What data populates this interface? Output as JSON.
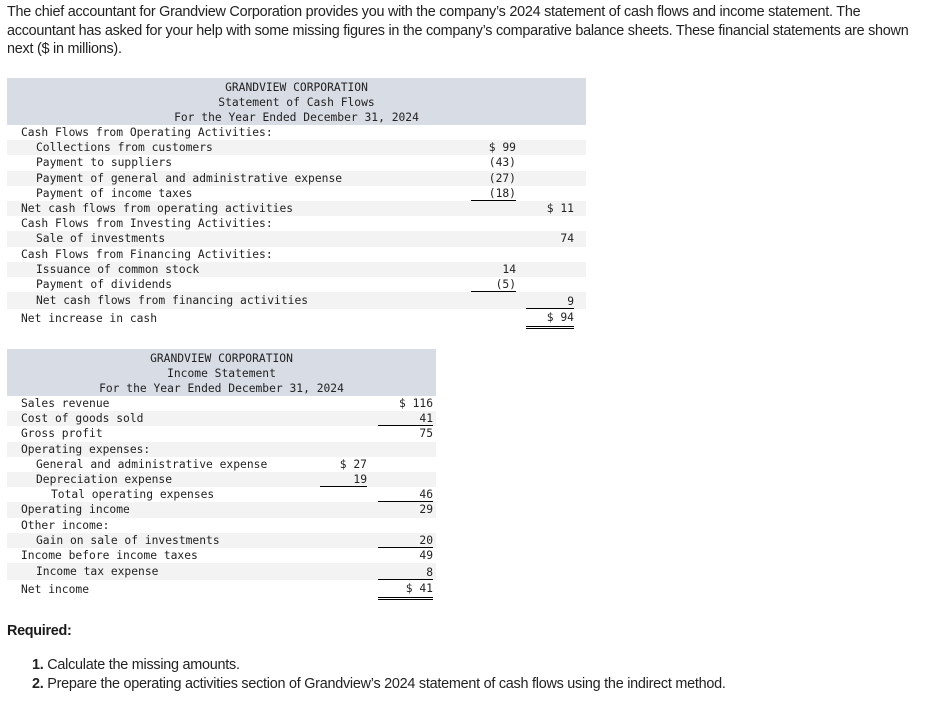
{
  "intro": "The chief accountant for Grandview Corporation provides you with the company’s 2024 statement of cash flows and income statement. The accountant has asked for your help with some missing figures in the company’s comparative balance sheets. These financial statements are shown next ($ in millions).",
  "cash_flows": {
    "company": "GRANDVIEW CORPORATION",
    "title": "Statement of Cash Flows",
    "period": "For the Year Ended December 31, 2024",
    "rows": [
      {
        "label": "Cash Flows from Operating Activities:",
        "c1": "",
        "c2": ""
      },
      {
        "label": "Collections from customers",
        "c1": "$ 99",
        "c2": ""
      },
      {
        "label": "Payment to suppliers",
        "c1": "(43)",
        "c2": ""
      },
      {
        "label": "Payment of general and administrative expense",
        "c1": "(27)",
        "c2": ""
      },
      {
        "label": "Payment of income taxes",
        "c1": "(18)",
        "c2": ""
      },
      {
        "label": "Net cash flows from operating activities",
        "c1": "",
        "c2": "$ 11"
      },
      {
        "label": "Cash Flows from Investing Activities:",
        "c1": "",
        "c2": ""
      },
      {
        "label": "Sale of investments",
        "c1": "",
        "c2": "74"
      },
      {
        "label": "Cash Flows from Financing Activities:",
        "c1": "",
        "c2": ""
      },
      {
        "label": "Issuance of common stock",
        "c1": "14",
        "c2": ""
      },
      {
        "label": "Payment of dividends",
        "c1": "(5)",
        "c2": ""
      },
      {
        "label": "Net cash flows from financing activities",
        "c1": "",
        "c2": "9"
      },
      {
        "label": "Net increase in cash",
        "c1": "",
        "c2": "$ 94"
      }
    ]
  },
  "income": {
    "company": "GRANDVIEW CORPORATION",
    "title": "Income Statement",
    "period": "For the Year Ended December 31, 2024",
    "rows": [
      {
        "label": "Sales revenue",
        "c1": "",
        "c2": "$ 116"
      },
      {
        "label": "Cost of goods sold",
        "c1": "",
        "c2": "41"
      },
      {
        "label": "Gross profit",
        "c1": "",
        "c2": "75"
      },
      {
        "label": "Operating expenses:",
        "c1": "",
        "c2": ""
      },
      {
        "label": "General and administrative expense",
        "c1": "$ 27",
        "c2": ""
      },
      {
        "label": "Depreciation expense",
        "c1": "19",
        "c2": ""
      },
      {
        "label": "Total operating expenses",
        "c1": "",
        "c2": "46"
      },
      {
        "label": "Operating income",
        "c1": "",
        "c2": "29"
      },
      {
        "label": "Other income:",
        "c1": "",
        "c2": ""
      },
      {
        "label": "Gain on sale of investments",
        "c1": "",
        "c2": "20"
      },
      {
        "label": "Income before income taxes",
        "c1": "",
        "c2": "49"
      },
      {
        "label": "Income tax expense",
        "c1": "",
        "c2": "8"
      },
      {
        "label": "Net income",
        "c1": "",
        "c2": "$ 41"
      }
    ]
  },
  "required": {
    "heading": "Required:",
    "items": [
      {
        "num": "1.",
        "text": " Calculate the missing amounts."
      },
      {
        "num": "2.",
        "text": " Prepare the operating activities section of Grandview’s 2024 statement of cash flows using the indirect method."
      }
    ]
  }
}
